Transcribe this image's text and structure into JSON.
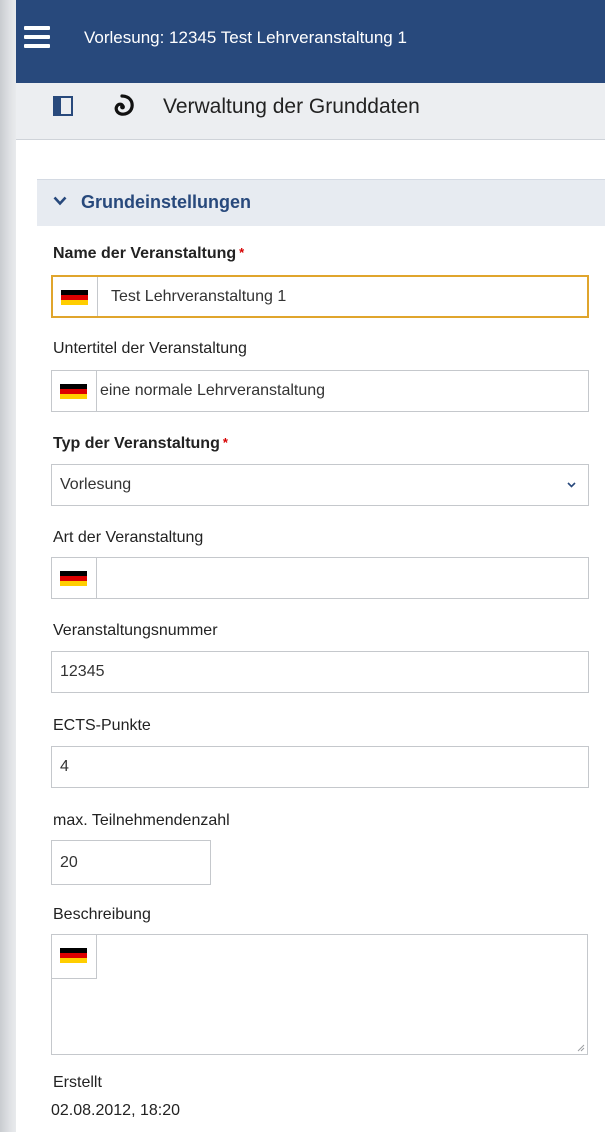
{
  "topbar": {
    "title": "Vorlesung: 12345 Test Lehrveranstaltung 1",
    "menu_icon": "hamburger-menu-icon"
  },
  "header": {
    "title": "Verwaltung der Grunddaten",
    "sidebar_icon": "sidebar-toggle-icon",
    "swirl_icon": "swirl-icon"
  },
  "section": {
    "label": "Grundeinstellungen",
    "icon": "chevron-down-icon"
  },
  "colors": {
    "primary": "#28497c",
    "focus_border": "#e0a52c",
    "required": "#d60000"
  },
  "form": {
    "name": {
      "label": "Name der Veranstaltung",
      "required": "*",
      "value": "Test Lehrveranstaltung 1"
    },
    "subtitle": {
      "label": "Untertitel der Veranstaltung",
      "value": "eine normale Lehrveranstaltung"
    },
    "type": {
      "label": "Typ der Veranstaltung",
      "required": "*",
      "value": "Vorlesung"
    },
    "kind": {
      "label": "Art der Veranstaltung",
      "value": ""
    },
    "number": {
      "label": "Veranstaltungsnummer",
      "value": "12345"
    },
    "ects": {
      "label": "ECTS-Punkte",
      "value": "4"
    },
    "max_participants": {
      "label": "max. Teilnehmendenzahl",
      "value": "20"
    },
    "description": {
      "label": "Beschreibung",
      "value": ""
    }
  },
  "meta": {
    "created_label": "Erstellt",
    "created_value": "02.08.2012, 18:20"
  }
}
